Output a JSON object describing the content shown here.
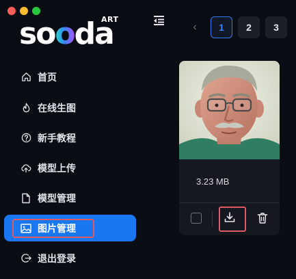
{
  "logo": {
    "wordmark": "soda",
    "tag": "ART"
  },
  "pagination": {
    "prev_symbol": "‹",
    "pages": [
      "1",
      "2",
      "3"
    ],
    "current": "1"
  },
  "nav": {
    "items": [
      {
        "label": "首页",
        "icon": "home-icon"
      },
      {
        "label": "在线生图",
        "icon": "flame-icon"
      },
      {
        "label": "新手教程",
        "icon": "help-circle-icon"
      },
      {
        "label": "模型上传",
        "icon": "cloud-upload-icon"
      },
      {
        "label": "模型管理",
        "icon": "file-icon"
      },
      {
        "label": "图片管理",
        "icon": "image-icon",
        "active": true
      },
      {
        "label": "退出登录",
        "icon": "logout-icon"
      }
    ]
  },
  "card": {
    "file_size": "3.23 MB"
  },
  "colors": {
    "accent": "#1a77f2",
    "highlight": "#e05a63",
    "background": "#0b0d14"
  }
}
